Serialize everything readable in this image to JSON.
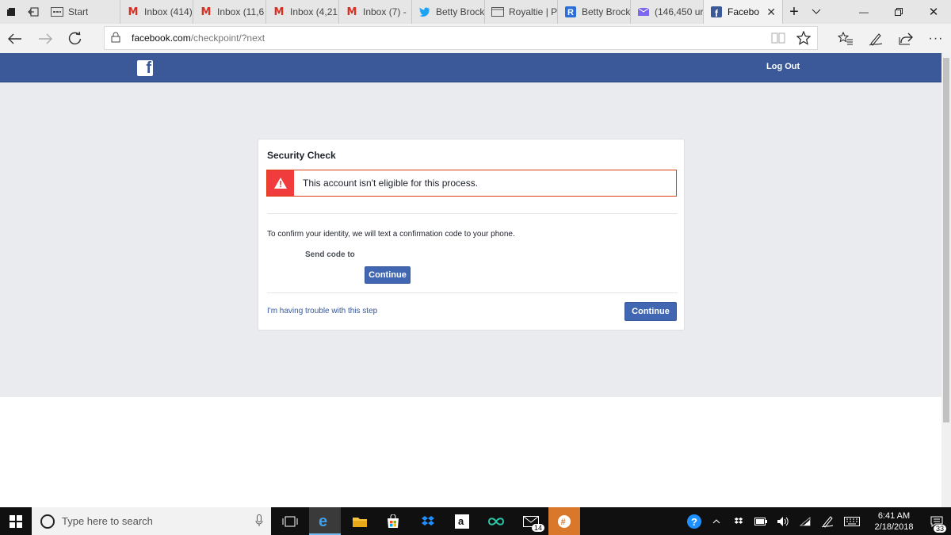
{
  "browser": {
    "tabs": [
      {
        "label": "Start",
        "icon": "start-page-icon"
      },
      {
        "label": "Inbox (414)",
        "icon": "gmail-icon"
      },
      {
        "label": "Inbox (11,6",
        "icon": "gmail-icon"
      },
      {
        "label": "Inbox (4,21",
        "icon": "gmail-icon"
      },
      {
        "label": "Inbox (7) -",
        "icon": "gmail-icon"
      },
      {
        "label": "Betty Brock",
        "icon": "twitter-icon"
      },
      {
        "label": "Royaltie | P",
        "icon": "page-icon"
      },
      {
        "label": "Betty Brock",
        "icon": "app-icon"
      },
      {
        "label": "(146,450 ur",
        "icon": "mail-icon"
      },
      {
        "label": "Facebo",
        "icon": "facebook-icon",
        "active": true
      }
    ],
    "url_domain": "facebook.com",
    "url_path": "/checkpoint/?next"
  },
  "facebook": {
    "logout": "Log Out",
    "card": {
      "title": "Security Check",
      "error": "This account isn't eligible for this process.",
      "confirm_text": "To confirm your identity, we will text a confirmation code to your phone.",
      "send_label": "Send code to",
      "continue_small": "Continue",
      "trouble_link": "I'm having trouble with this step",
      "continue_main": "Continue"
    },
    "colors": {
      "brand": "#3b5998",
      "button": "#4267b2",
      "error": "#f03c3c"
    }
  },
  "taskbar": {
    "search_placeholder": "Type here to search",
    "mail_badge": "14",
    "time": "6:41 AM",
    "date": "2/18/2018",
    "notification_badge": "33"
  }
}
